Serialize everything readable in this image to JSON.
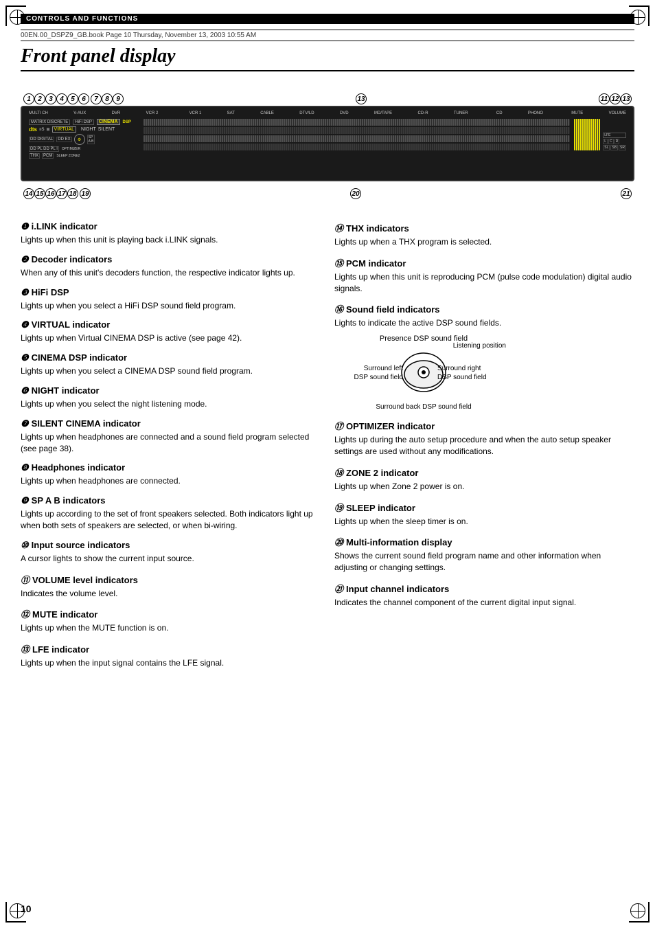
{
  "page": {
    "section_label": "CONTROLS AND FUNCTIONS",
    "file_info": "00EN.00_DSPZ9_GB.book  Page 10  Thursday, November 13, 2003  10:55 AM",
    "title": "Front panel display",
    "page_number": "10"
  },
  "device": {
    "top_numbers": [
      "❶",
      "❷",
      "❸",
      "❹",
      "❺",
      "❻❼",
      "❽",
      "❾",
      "⑬",
      "⑪",
      "⑫",
      "⑬"
    ],
    "bottom_numbers": [
      "⑭",
      "⑮",
      "⑯",
      "⑰",
      "⑱",
      "",
      "⑳",
      "",
      "㉑"
    ],
    "input_labels": [
      "MULTI CH",
      "V-AUX",
      "DVR",
      "VCR 2",
      "VCR 1",
      "SAT",
      "CABLE",
      "DTV/LD",
      "DVD",
      "MD/TAPE",
      "CD-R",
      "TUNER",
      "CD",
      "PHONO"
    ]
  },
  "indicators": {
    "left_column": [
      {
        "num": "❶",
        "title": "i.LINK indicator",
        "desc": "Lights up when this unit is playing back i.LINK signals."
      },
      {
        "num": "❷",
        "title": "Decoder indicators",
        "desc": "When any of this unit's decoders function, the respective indicator lights up."
      },
      {
        "num": "❸",
        "title": "HiFi DSP",
        "desc": "Lights up when you select a HiFi DSP sound field program."
      },
      {
        "num": "❹",
        "title": "VIRTUAL indicator",
        "desc": "Lights up when Virtual CINEMA DSP is active (see page 42)."
      },
      {
        "num": "❺",
        "title": "CINEMA DSP indicator",
        "desc": "Lights up when you select a CINEMA DSP sound field program."
      },
      {
        "num": "❻",
        "title": "NIGHT indicator",
        "desc": "Lights up when you select the night listening mode."
      },
      {
        "num": "❼",
        "title": "SILENT CINEMA indicator",
        "desc": "Lights up when headphones are connected and a sound field program selected (see page 38)."
      },
      {
        "num": "❽",
        "title": "Headphones indicator",
        "desc": "Lights up when headphones are connected."
      },
      {
        "num": "❾",
        "title": "SP A B indicators",
        "desc": "Lights up according to the set of front speakers selected. Both indicators light up when both sets of speakers are selected, or when bi-wiring."
      },
      {
        "num": "⑩",
        "title": "Input source indicators",
        "desc": "A cursor lights to show the current input source."
      },
      {
        "num": "⑪",
        "title": "VOLUME level indicators",
        "desc": "Indicates the volume level."
      },
      {
        "num": "⑫",
        "title": "MUTE indicator",
        "desc": "Lights up when the MUTE function is on."
      },
      {
        "num": "⑬",
        "title": "LFE indicator",
        "desc": "Lights up when the input signal contains the LFE signal."
      }
    ],
    "right_column": [
      {
        "num": "⑭",
        "title": "THX indicators",
        "desc": "Lights up when a THX program is selected."
      },
      {
        "num": "⑮",
        "title": "PCM indicator",
        "desc": "Lights up when this unit is reproducing PCM (pulse code modulation) digital audio signals."
      },
      {
        "num": "⑯",
        "title": "Sound field indicators",
        "desc": "Lights to indicate the active DSP sound fields.",
        "has_diagram": true
      },
      {
        "num": "⑰",
        "title": "OPTIMIZER indicator",
        "desc": "Lights up during the auto setup procedure and when the auto setup speaker settings are used without any modifications."
      },
      {
        "num": "⑱",
        "title": "ZONE 2 indicator",
        "desc": "Lights up when Zone 2 power is on."
      },
      {
        "num": "⑲",
        "title": "SLEEP indicator",
        "desc": "Lights up when the sleep timer is on."
      },
      {
        "num": "⑳",
        "title": "Multi-information display",
        "desc": "Shows the current sound field program name and other information when adjusting or changing settings."
      },
      {
        "num": "㉑",
        "title": "Input channel indicators",
        "desc": "Indicates the channel component of the current digital input signal."
      }
    ]
  },
  "sound_field_diagram": {
    "top_label": "Presence DSP sound field",
    "right_top_label": "Listening position",
    "left_label": "Surround left\nDSP sound field",
    "right_label": "Surround right\nDSP sound field",
    "bottom_label": "Surround back DSP sound field"
  }
}
